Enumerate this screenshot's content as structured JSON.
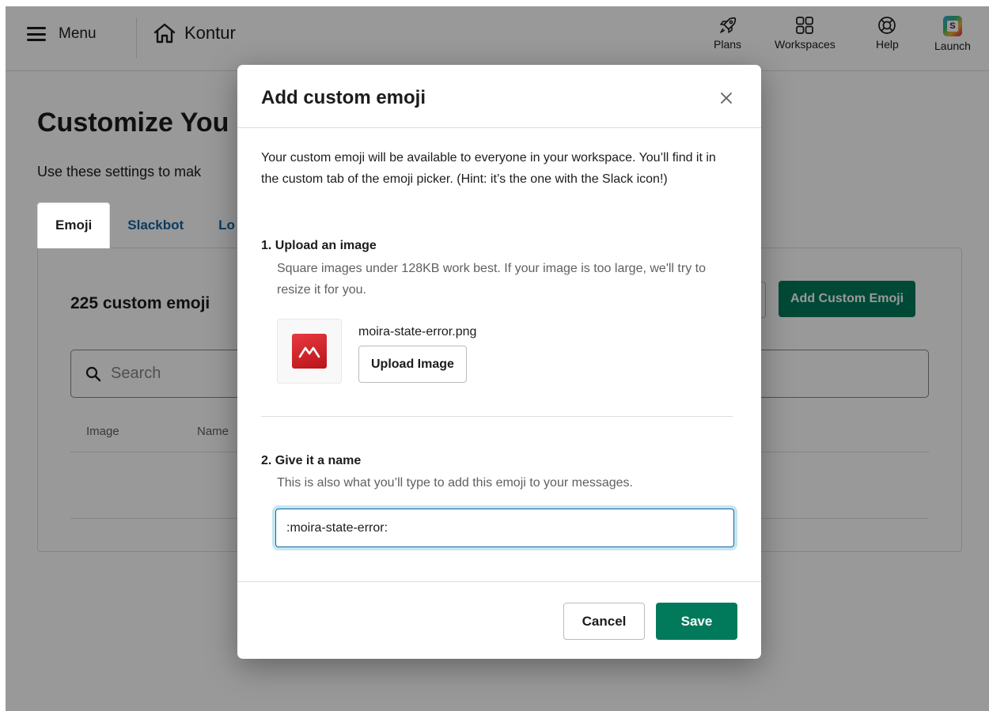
{
  "topbar": {
    "menu_label": "Menu",
    "workspace_name": "Kontur",
    "nav": [
      {
        "label": "Plans",
        "icon": "rocket-icon"
      },
      {
        "label": "Workspaces",
        "icon": "grid-icon"
      },
      {
        "label": "Help",
        "icon": "lifebuoy-icon"
      },
      {
        "label": "Launch",
        "icon": "slack-launch-icon"
      }
    ]
  },
  "page": {
    "title": "Customize You",
    "description": "Use these settings to mak",
    "tabs": [
      {
        "label": "Emoji",
        "active": true
      },
      {
        "label": "Slackbot",
        "active": false
      },
      {
        "label": "Lo",
        "active": false
      }
    ],
    "emoji_count": "225 custom emoji",
    "add_button": "Add Custom Emoji",
    "search_placeholder": "Search",
    "columns": [
      "Image",
      "Name"
    ]
  },
  "modal": {
    "title": "Add custom emoji",
    "intro": "Your custom emoji will be available to everyone in your workspace. You’ll find it in the custom tab of the emoji picker. (Hint: it’s the one with the Slack icon!)",
    "step1_title": "1. Upload an image",
    "step1_hint": "Square images under 128KB work best. If your image is too large, we'll try to resize it for you.",
    "file_name": "moira-state-error.png",
    "upload_button": "Upload Image",
    "step2_title": "2. Give it a name",
    "step2_hint": "This is also what you’ll type to add this emoji to your messages.",
    "name_value": ":moira-state-error:",
    "cancel_button": "Cancel",
    "save_button": "Save"
  },
  "colors": {
    "primary_green": "#007a5a",
    "link_blue": "#1264a3",
    "focus_blue": "#1d9bd1"
  }
}
